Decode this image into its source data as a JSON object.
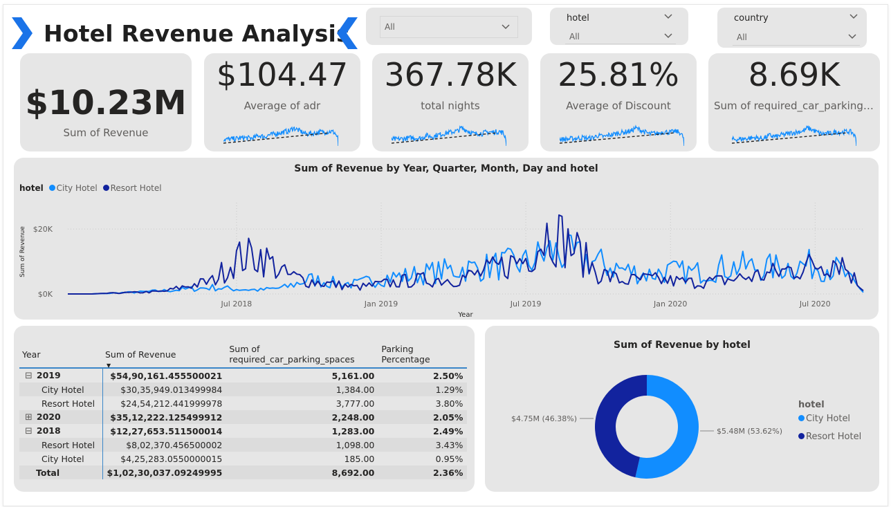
{
  "header": {
    "title": "Hotel Revenue Analysis"
  },
  "slicers": [
    {
      "label": "",
      "value": "All"
    },
    {
      "label": "hotel",
      "value": "All"
    },
    {
      "label": "country",
      "value": "All"
    }
  ],
  "kpis": [
    {
      "value": "$10.23M",
      "label": "Sum of Revenue"
    },
    {
      "value": "$104.47",
      "label": "Average of adr"
    },
    {
      "value": "367.78K",
      "label": "total nights"
    },
    {
      "value": "25.81%",
      "label": "Average of Discount"
    },
    {
      "value": "8.69K",
      "label": "Sum of required_car_parking_s..."
    }
  ],
  "colors": {
    "city_hotel": "#118dff",
    "resort_hotel": "#12239e",
    "card": "#e6e6e6"
  },
  "chart_data": [
    {
      "type": "line",
      "title": "Sum of Revenue by Year, Quarter, Month, Day and hotel",
      "xlabel": "Year",
      "ylabel": "Sum of Revenue",
      "legend_title": "hotel",
      "legend_position": "top-left",
      "x_ticks": [
        "Jul 2018",
        "Jan 2019",
        "Jul 2019",
        "Jan 2020",
        "Jul 2020"
      ],
      "y_ticks": [
        "$0K",
        "$20K"
      ],
      "ylim": [
        0,
        26000
      ],
      "x": [
        "2017-12",
        "2018-01",
        "2018-02",
        "2018-03",
        "2018-04",
        "2018-05",
        "2018-06",
        "2018-07",
        "2018-08",
        "2018-09",
        "2018-10",
        "2018-11",
        "2018-12",
        "2019-01",
        "2019-02",
        "2019-03",
        "2019-04",
        "2019-05",
        "2019-06",
        "2019-07",
        "2019-08",
        "2019-09",
        "2019-10",
        "2019-11",
        "2019-12",
        "2020-01",
        "2020-02",
        "2020-03",
        "2020-04",
        "2020-05",
        "2020-06",
        "2020-07",
        "2020-08",
        "2020-09"
      ],
      "series": [
        {
          "name": "City Hotel",
          "values": [
            0,
            0,
            300,
            600,
            1000,
            1500,
            2000,
            1500,
            1200,
            2000,
            4500,
            3500,
            3000,
            5000,
            5500,
            6500,
            7500,
            8000,
            9000,
            9500,
            13000,
            11500,
            9500,
            7500,
            6000,
            7000,
            6500,
            8000,
            8500,
            8000,
            8500,
            9000,
            7500,
            500
          ]
        },
        {
          "name": "Resort Hotel",
          "values": [
            0,
            0,
            300,
            500,
            800,
            2500,
            4000,
            11000,
            12000,
            6000,
            4000,
            3000,
            2000,
            3000,
            4000,
            4500,
            4500,
            6000,
            8500,
            11000,
            20000,
            14000,
            6500,
            4000,
            4500,
            4000,
            3500,
            4000,
            5000,
            6000,
            7500,
            9000,
            11000,
            1000
          ]
        }
      ]
    },
    {
      "type": "pie",
      "title": "Sum of Revenue by hotel",
      "legend_title": "hotel",
      "legend_position": "right",
      "categories": [
        "City Hotel",
        "Resort Hotel"
      ],
      "values": [
        5.48,
        4.75
      ],
      "percents": [
        53.62,
        46.38
      ],
      "data_labels": [
        "$5.48M (53.62%)",
        "$4.75M (46.38%)"
      ],
      "units": "$M"
    }
  ],
  "matrix": {
    "headers": [
      "Year",
      "Sum of Revenue",
      "Sum of required_car_parking_spaces",
      "Parking Percentage"
    ],
    "rows": [
      {
        "label": "2019",
        "level": 0,
        "toggle": "⊟",
        "revenue": "$54,90,161.455500021",
        "parking": "5,161.00",
        "pct": "2.50%"
      },
      {
        "label": "City Hotel",
        "level": 1,
        "toggle": "",
        "revenue": "$30,35,949.013499984",
        "parking": "1,384.00",
        "pct": "1.29%"
      },
      {
        "label": "Resort Hotel",
        "level": 1,
        "toggle": "",
        "revenue": "$24,54,212.441999978",
        "parking": "3,777.00",
        "pct": "3.80%"
      },
      {
        "label": "2020",
        "level": 0,
        "toggle": "⊞",
        "revenue": "$35,12,222.125499912",
        "parking": "2,248.00",
        "pct": "2.05%"
      },
      {
        "label": "2018",
        "level": 0,
        "toggle": "⊟",
        "revenue": "$12,27,653.511500014",
        "parking": "1,283.00",
        "pct": "2.49%"
      },
      {
        "label": "Resort Hotel",
        "level": 1,
        "toggle": "",
        "revenue": "$8,02,370.456500002",
        "parking": "1,098.00",
        "pct": "3.43%"
      },
      {
        "label": "City Hotel",
        "level": 1,
        "toggle": "",
        "revenue": "$4,25,283.0550000015",
        "parking": "185.00",
        "pct": "0.95%"
      },
      {
        "label": "Total",
        "level": 0,
        "toggle": "",
        "revenue": "$1,02,30,037.09249995",
        "parking": "8,692.00",
        "pct": "2.36%"
      }
    ]
  }
}
